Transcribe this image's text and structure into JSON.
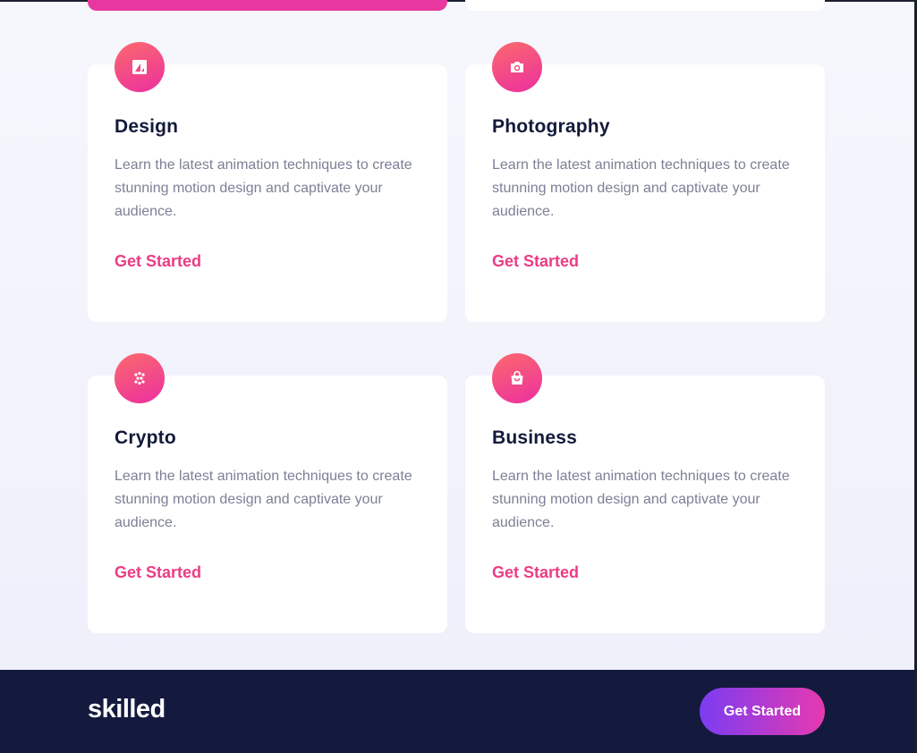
{
  "cards": [
    {
      "icon": "design-image-icon",
      "title": "Design",
      "description": "Learn the latest animation techniques to create stunning motion design and captivate your audience.",
      "cta": "Get Started"
    },
    {
      "icon": "camera-icon",
      "title": "Photography",
      "description": "Learn the latest animation techniques to create stunning motion design and captivate your audience.",
      "cta": "Get Started"
    },
    {
      "icon": "crypto-dots-icon",
      "title": "Crypto",
      "description": "Learn the latest animation techniques to create stunning motion design and captivate your audience.",
      "cta": "Get Started"
    },
    {
      "icon": "shopping-bag-icon",
      "title": "Business",
      "description": "Learn the latest animation techniques to create stunning motion design and captivate your audience.",
      "cta": "Get Started"
    }
  ],
  "footer": {
    "logo": "skilled",
    "button_label": "Get Started"
  },
  "colors": {
    "accent_pink": "#ec3c85",
    "icon_gradient_start": "#fb6a6d",
    "icon_gradient_end": "#ec2f9f",
    "footer_bg": "#131a3d",
    "button_gradient_start": "#7b3cf2",
    "button_gradient_end": "#e639b0"
  }
}
